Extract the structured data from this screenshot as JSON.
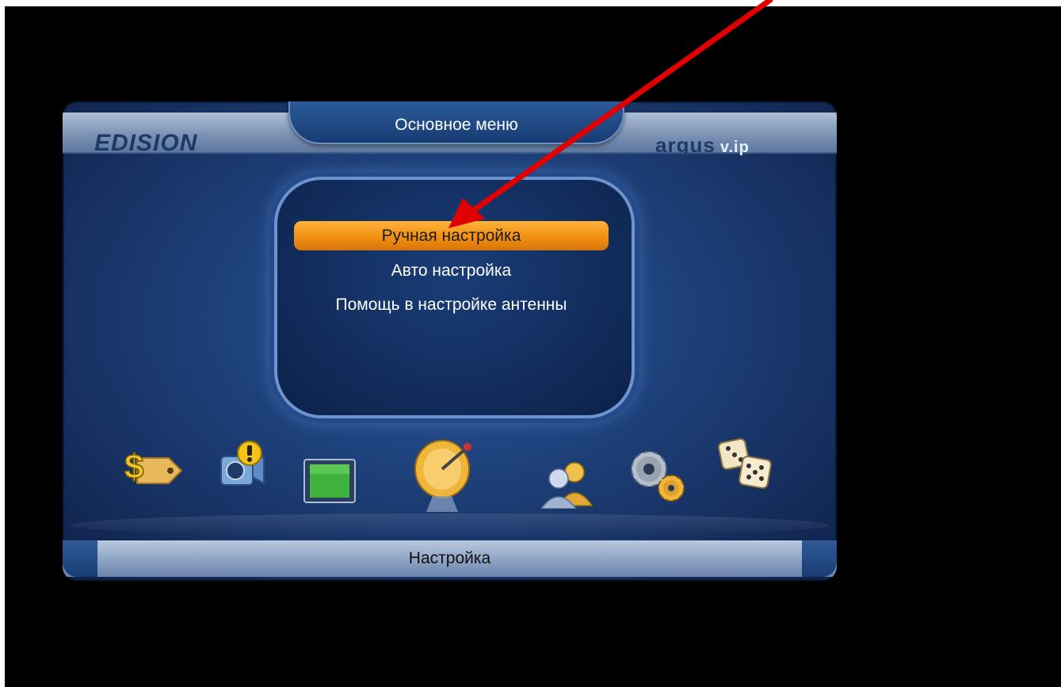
{
  "header": {
    "logo_left": "EDISION",
    "title": "Основное меню",
    "logo_right": "argus",
    "logo_right_suffix": "v.ip"
  },
  "menu": {
    "items": [
      {
        "label": "Ручная настройка",
        "selected": true
      },
      {
        "label": "Авто настройка",
        "selected": false
      },
      {
        "label": "Помощь в настройке антенны",
        "selected": false
      }
    ]
  },
  "icons": [
    {
      "name": "money-tag-icon"
    },
    {
      "name": "camera-warning-icon"
    },
    {
      "name": "tv-screen-icon"
    },
    {
      "name": "satellite-dish-icon",
      "selected": true
    },
    {
      "name": "users-icon"
    },
    {
      "name": "settings-gears-icon"
    },
    {
      "name": "dice-icon"
    }
  ],
  "footer": {
    "label": "Настройка"
  },
  "colors": {
    "selection": "#f29013",
    "arrow": "#e00000",
    "panel": "#1d3f78"
  }
}
